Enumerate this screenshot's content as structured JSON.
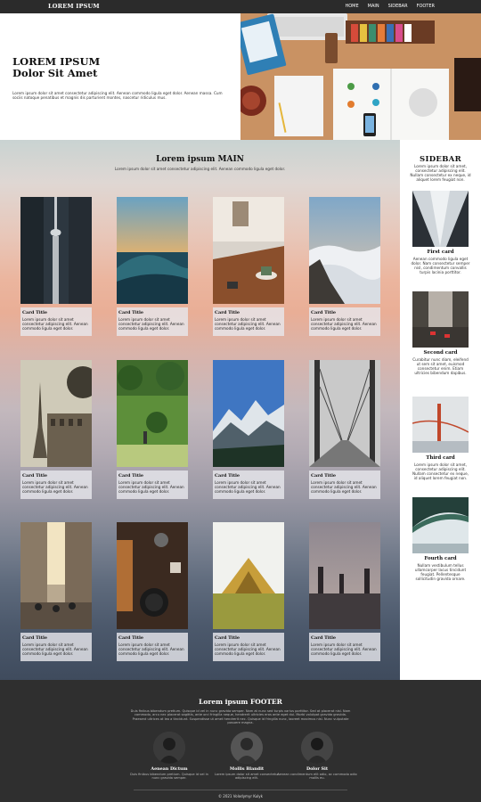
{
  "nav": {
    "brand": "LOREM IPSUM",
    "links": [
      "HOME",
      "MAIN",
      "SIDEBAR",
      "FOOTER"
    ]
  },
  "hero": {
    "title_line1": "LOREM IPSUM",
    "title_line2": "Dolor Sit Amet",
    "text": "Lorem ipsum dolor sit amet consectetur adipiscing elit. Aenean commodo ligula eget dolor. Aenean massa. Cum sociis natoque penatibus et magnis dis parturient montes, nascetur ridiculus mus."
  },
  "main": {
    "title": "Lorem ipsum MAIN",
    "subtitle": "Lorem ipsum dolor sit amet consectetur adipiscing elit. Aenean commodo ligula eget dolor.",
    "cards": [
      {
        "title": "Card Title",
        "text": "Lorem ipsum dolor sit amet consectetur adipiscing elit. Aenean commodo ligula eget dolor.",
        "image": "city-tower-photo"
      },
      {
        "title": "Card Title",
        "text": "Lorem ipsum dolor sit amet consectetur adipiscing elit. Aenean commodo ligula eget dolor.",
        "image": "ocean-wave-photo"
      },
      {
        "title": "Card Title",
        "text": "Lorem ipsum dolor sit amet consectetur adipiscing elit. Aenean commodo ligula eget dolor.",
        "image": "cafe-table-photo"
      },
      {
        "title": "Card Title",
        "text": "Lorem ipsum dolor sit amet consectetur adipiscing elit. Aenean commodo ligula eget dolor.",
        "image": "clouds-mountain-photo"
      },
      {
        "title": "Card Title",
        "text": "Lorem ipsum dolor sit amet consectetur adipiscing elit. Aenean commodo ligula eget dolor.",
        "image": "eiffel-tower-photo"
      },
      {
        "title": "Card Title",
        "text": "Lorem ipsum dolor sit amet consectetur adipiscing elit. Aenean commodo ligula eget dolor.",
        "image": "green-pasture-photo"
      },
      {
        "title": "Card Title",
        "text": "Lorem ipsum dolor sit amet consectetur adipiscing elit. Aenean commodo ligula eget dolor.",
        "image": "mountain-range-photo"
      },
      {
        "title": "Card Title",
        "text": "Lorem ipsum dolor sit amet consectetur adipiscing elit. Aenean commodo ligula eget dolor.",
        "image": "bridge-cables-photo"
      },
      {
        "title": "Card Title",
        "text": "Lorem ipsum dolor sit amet consectetur adipiscing elit. Aenean commodo ligula eget dolor.",
        "image": "city-street-crowd-photo"
      },
      {
        "title": "Card Title",
        "text": "Lorem ipsum dolor sit amet consectetur adipiscing elit. Aenean commodo ligula eget dolor.",
        "image": "kitchen-spices-photo"
      },
      {
        "title": "Card Title",
        "text": "Lorem ipsum dolor sit amet consectetur adipiscing elit. Aenean commodo ligula eget dolor.",
        "image": "tent-photo"
      },
      {
        "title": "Card Title",
        "text": "Lorem ipsum dolor sit amet consectetur adipiscing elit. Aenean commodo ligula eget dolor.",
        "image": "statue-bridge-photo"
      }
    ]
  },
  "sidebar": {
    "title": "SIDEBAR",
    "intro": "Lorem ipsum dolor sit amet, consectetur adipiscing elit. Nullam consectetur ex neque, id aliquet lorem feugiat non.",
    "cards": [
      {
        "title": "First card",
        "text": "Aenean commodo ligula eget dolor. Nam consectetur semper nisl, condimentum convallis turpis lacinia porttitor.",
        "image": "skyscrapers-photo"
      },
      {
        "title": "Second card",
        "text": "Curabitur nunc diam, eleifend ut sem sit amet, euismod consectetur enim. Etiam ultricies bibendum dapibus.",
        "image": "city-traffic-photo"
      },
      {
        "title": "Third card",
        "text": "Lorem ipsum dolor sit amet, consectetur adipiscing elit. Nullam consectetur ex neque, id aliquet lorem feugiat non.",
        "image": "golden-gate-photo"
      },
      {
        "title": "Fourth card",
        "text": "Nullam vestibulum tellus ullamcorper lacus tincidunt feugiat. Pellentesque sollicitudin gravida ornare.",
        "image": "bridge-underside-photo"
      }
    ]
  },
  "footer": {
    "title": "Lorem ipsum FOOTER",
    "text": "Duis finibus bibendum pretium. Quisque id vel in nunc gravida semper. Nam at nunc sed turpis varius porttitor. Sed at placerat nisl. Nam commodo, arcu nec placerat sagittis, ante orci fringilla neque, hendrerit ultricies eros ante eget dui. Morbi volutpat gravida gravida. Praesent ultrices at leo a tincidunt. Suspendisse ut amet hendrerit nec. Quisque id fringilla nunc, laoreet maximus nisl. Nunc vulputate posuere magna.",
    "people": [
      {
        "name": "Aenean Dictum",
        "desc": "Duis finibus bibendum pretium. Quisque id vel in nunc gravida semper."
      },
      {
        "name": "Mollis Blandit",
        "desc": "Lorem ipsum dolor sit amet consectetur adipiscing elit."
      },
      {
        "name": "Dolor Sit",
        "desc": "Aenean condimentum elit odio, ac commodo odio mollis eu."
      }
    ],
    "copyright": "© 2021 Volodymyr Kulyk"
  }
}
